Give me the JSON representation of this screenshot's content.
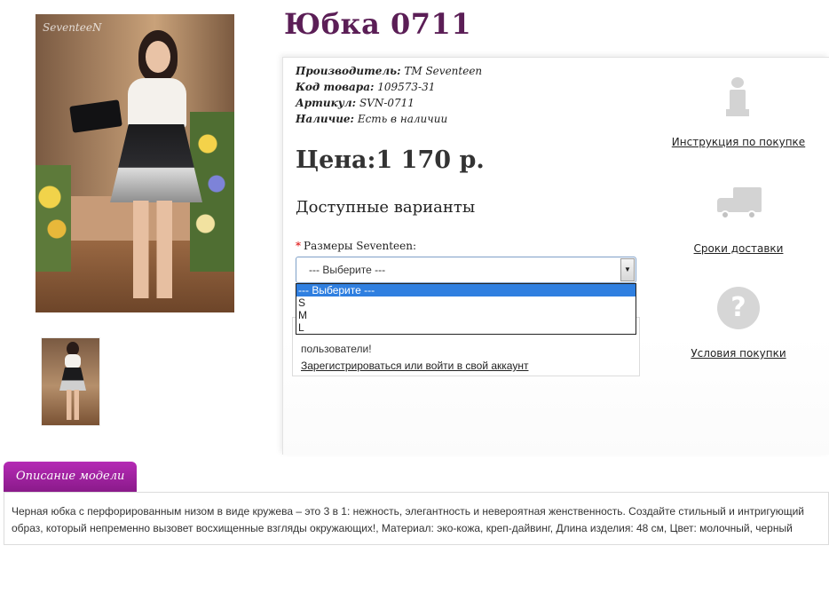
{
  "product": {
    "title": "Юбка 0711",
    "image_watermark": "SeventeeN"
  },
  "meta": {
    "manufacturer_label": "Производитель:",
    "manufacturer_value": "TM Seventeen",
    "code_label": "Код товара:",
    "code_value": "109573-31",
    "sku_label": "Артикул:",
    "sku_value": "SVN-0711",
    "stock_label": "Наличие:",
    "stock_value": "Есть в наличии"
  },
  "price": "Цена:1 170 р.",
  "variants": {
    "title": "Доступные варианты",
    "required_mark": "*",
    "size_label": "Размеры Seventeen:",
    "selected": "--- Выберите ---",
    "options": [
      "--- Выберите ---",
      "S",
      "M",
      "L"
    ]
  },
  "register": {
    "text": "пользователи!",
    "link": "Зарегистрироваться или войти в свой аккаунт"
  },
  "side_links": {
    "purchase_guide": "Инструкция по покупке",
    "delivery": "Сроки доставки",
    "terms": "Условия покупки"
  },
  "description": {
    "tab_label": "Описание модели",
    "text": "Черная юбка с перфорированным низом в виде кружева – это 3 в 1: нежность, элегантность и невероятная женственность. Создайте стильный и интригующий образ, который непременно вызовет восхищенные взгляды окружающих!, Материал: эко-кожа, креп-дайвинг, Длина изделия: 48 см, Цвет: молочный, черный"
  },
  "colors": {
    "title": "#5b1e56",
    "tab": "#a020a0",
    "dropdown_selected": "#2f7fe0"
  }
}
